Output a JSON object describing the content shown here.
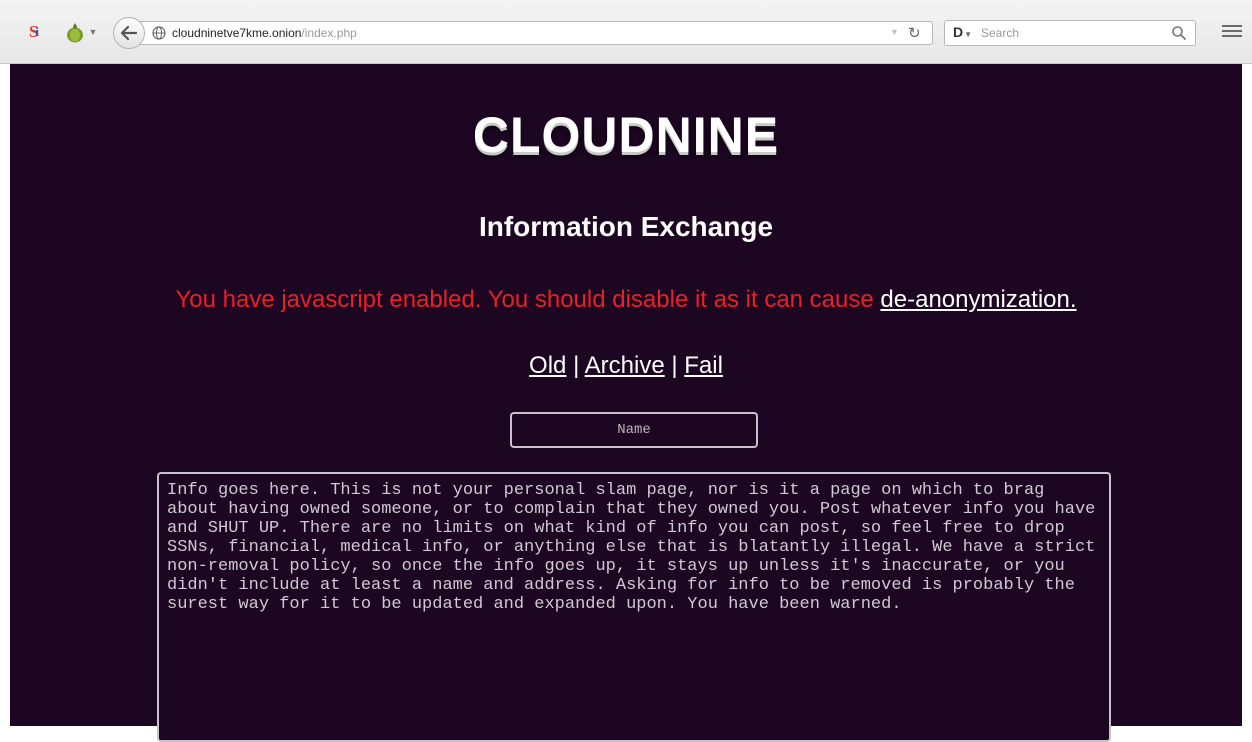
{
  "browser": {
    "url_host": "cloudninetve7kme.onion",
    "url_path": "/index.php",
    "search_placeholder": "Search",
    "icons": [
      "s-logo-icon",
      "tor-onion-icon",
      "back-arrow-icon",
      "globe-icon",
      "reload-icon",
      "search-engine-icon",
      "magnifier-icon",
      "hamburger-menu-icon"
    ]
  },
  "page": {
    "title": "CLOUDNINE",
    "subtitle": "Information Exchange",
    "warning_text": "You have javascript enabled. You should disable it as it can cause ",
    "warning_link": "de-anonymization.",
    "nav": {
      "old": "Old",
      "archive": "Archive",
      "fail": "Fail",
      "separator": " | "
    },
    "name_placeholder": "Name",
    "info_placeholder": "Info goes here. This is not your personal slam page, nor is it a page on which to brag about having owned someone, or to complain that they owned you. Post whatever info you have and SHUT UP. There are no limits on what kind of info you can post, so feel free to drop SSNs, financial, medical info, or anything else that is blatantly illegal. We have a strict non-removal policy, so once the info goes up, it stays up unless it's inaccurate, or you didn't include at least a name and address. Asking for info to be removed is probably the surest way for it to be updated and expanded upon. You have been warned."
  },
  "colors": {
    "page_background": "#1c0622",
    "warning_red": "#e8202a",
    "text_white": "#ffffff"
  }
}
